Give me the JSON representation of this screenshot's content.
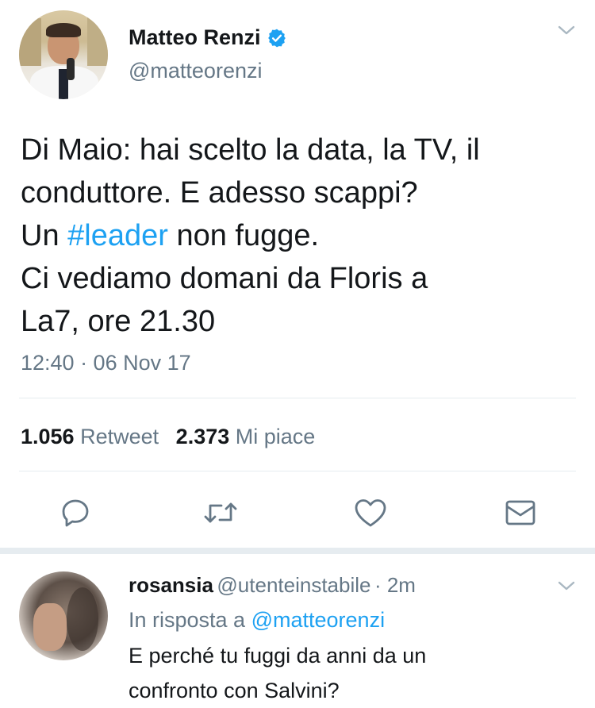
{
  "tweet": {
    "author_name": "Matteo Renzi",
    "author_handle": "@matteorenzi",
    "text_lines": [
      "Di Maio: hai scelto la data, la TV, il",
      "conduttore. E adesso scappi?",
      "Un ",
      "#leader",
      " non fugge.",
      "Ci vediamo domani da Floris a",
      "La7, ore 21.30"
    ],
    "timestamp": "12:40 · 06 Nov 17",
    "retweet_count": "1.056",
    "retweet_label": "Retweet",
    "like_count": "2.373",
    "like_label": "Mi piace"
  },
  "actions": {
    "icons": [
      "reply-icon",
      "retweet-icon",
      "like-icon",
      "message-icon"
    ]
  },
  "reply": {
    "author_name": "rosansia",
    "author_handle": "@utenteinstabile",
    "time": "· 2m",
    "in_reply_prefix": "In risposta a",
    "in_reply_handle": "@matteorenzi",
    "text_lines": [
      "E perché tu fuggi da anni da un",
      "confronto con Salvini?"
    ]
  },
  "colors": {
    "accent": "#1da1f2",
    "secondary_text": "#657786",
    "divider": "#e6ecf0"
  }
}
